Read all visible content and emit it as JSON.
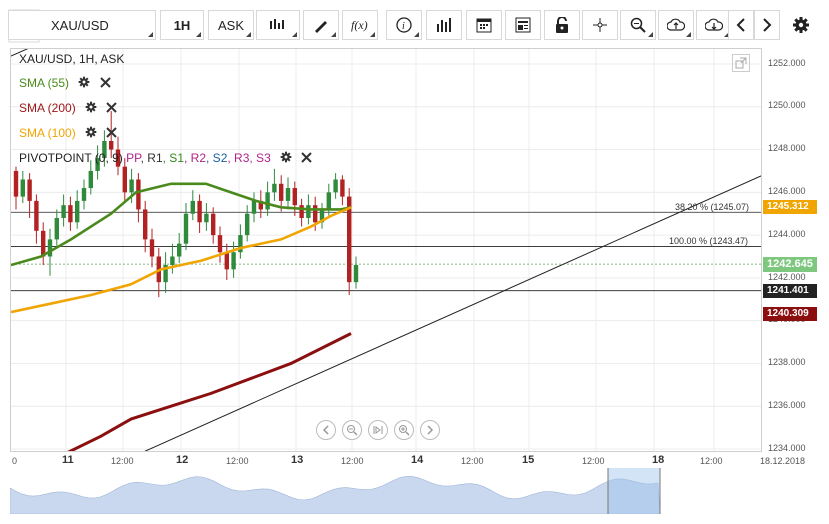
{
  "toolbar": {
    "symbol": "XAU/USD",
    "interval": "1H",
    "price_type": "ASK",
    "icons": [
      "menu-icon",
      "candlestick-icon",
      "draw-icon",
      "function-icon",
      "info-icon",
      "volume-icon",
      "calendar-icon",
      "news-icon",
      "lock-icon",
      "crosshair-icon",
      "zoom-icon",
      "upload-icon",
      "download-icon",
      "chevron-left-icon",
      "chevron-right-icon",
      "gear-icon"
    ]
  },
  "chart": {
    "title": "XAU/USD, 1H, ASK",
    "legend": [
      {
        "label": "SMA (55)",
        "color": "#4a8a1c"
      },
      {
        "label": "SMA (200)",
        "color": "#a01818"
      },
      {
        "label": "SMA (100)",
        "color": "#f0a500"
      }
    ],
    "pivot": {
      "label": "PIVOTPOINT (0, 9)",
      "parts": [
        {
          "text": "PP",
          "color": "#b0238a"
        },
        {
          "text": "R1",
          "color": "#333333"
        },
        {
          "text": "S1",
          "color": "#2f8a1c"
        },
        {
          "text": "R2",
          "color": "#b0238a"
        },
        {
          "text": "S2",
          "color": "#1a5fa0"
        },
        {
          "text": "R3",
          "color": "#b0238a"
        },
        {
          "text": "S3",
          "color": "#b0238a"
        }
      ]
    },
    "fib_levels": [
      {
        "label": "38.20 % (1245.07)"
      },
      {
        "label": "100.00 % (1243.47)"
      }
    ]
  },
  "price_axis": {
    "ticks": [
      "1252.000",
      "1250.000",
      "1248.000",
      "1246.000",
      "1244.000",
      "1242.000",
      "1240.000",
      "1238.000",
      "1236.000",
      "1234.000"
    ],
    "tags": [
      {
        "value": "1245.312",
        "color": "#f0a500"
      },
      {
        "value": "1242.645",
        "color": "#7ec77e"
      },
      {
        "value": "1241.401",
        "color": "#222222"
      },
      {
        "value": "1240.309",
        "color": "#8b0f0f"
      }
    ]
  },
  "time_axis": {
    "labels": [
      {
        "text": "0",
        "big": false
      },
      {
        "text": "11",
        "big": true
      },
      {
        "text": "12:00",
        "big": false
      },
      {
        "text": "12",
        "big": true
      },
      {
        "text": "12:00",
        "big": false
      },
      {
        "text": "13",
        "big": true
      },
      {
        "text": "12:00",
        "big": false
      },
      {
        "text": "14",
        "big": true
      },
      {
        "text": "12:00",
        "big": false
      },
      {
        "text": "15",
        "big": true
      },
      {
        "text": "12:00",
        "big": false
      },
      {
        "text": "18",
        "big": true
      },
      {
        "text": "12:00",
        "big": false
      },
      {
        "text": "18.12.2018",
        "big": false
      }
    ]
  },
  "colors": {
    "bull": "#2f8a3c",
    "bear": "#b22222",
    "sma55": "#4a8a1c",
    "sma100": "#f0a500",
    "sma200": "#8b0f0f"
  }
}
